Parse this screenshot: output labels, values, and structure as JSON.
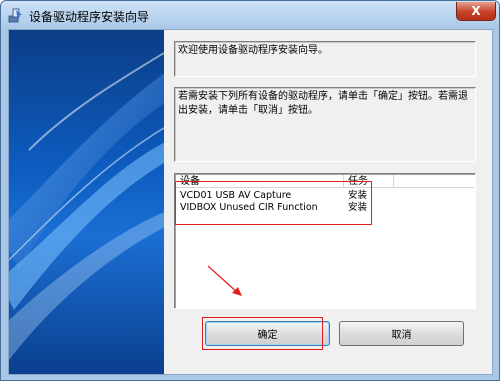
{
  "window": {
    "title": "设备驱动程序安装向导",
    "close_label": "X"
  },
  "welcome_text": "欢迎使用设备驱动程序安装向导。",
  "instruction_text": "若需安装下列所有设备的驱动程序，请单击「确定」按钮。若需退出安装，请单击「取消」按钮。",
  "device_list": {
    "columns": [
      "设备",
      "任务"
    ],
    "rows": [
      {
        "device": "VCD01 USB AV Capture",
        "task": "安装"
      },
      {
        "device": "VIDBOX Unused CIR Function",
        "task": "安装"
      }
    ]
  },
  "buttons": {
    "ok": "确定",
    "cancel": "取消"
  },
  "colors": {
    "annotation": "#e0201c",
    "side_art": "#0d5cc0"
  },
  "icons": {
    "title": "installer-icon",
    "close": "close-icon",
    "annotation": "arrow-icon"
  }
}
